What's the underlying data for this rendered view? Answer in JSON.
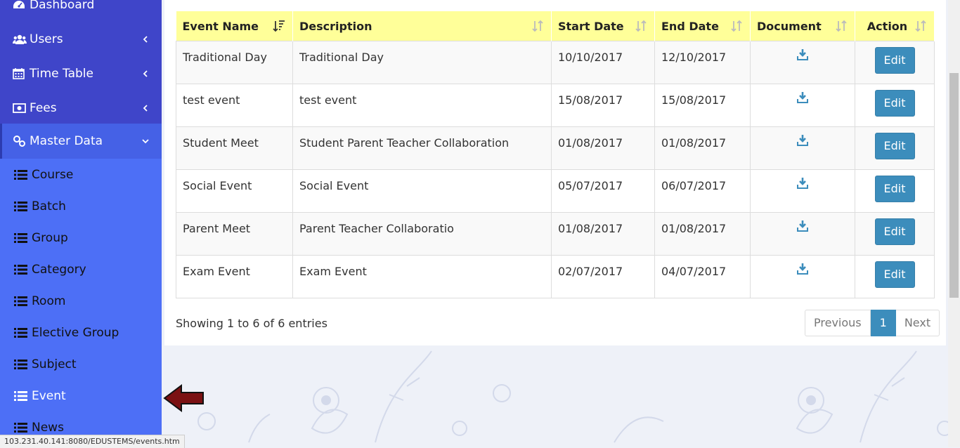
{
  "sidebar": {
    "top_items": [
      {
        "label": "Dashboard",
        "icon": "dashboard-icon"
      },
      {
        "label": "Users",
        "icon": "users-icon"
      },
      {
        "label": "Time Table",
        "icon": "calendar-icon"
      },
      {
        "label": "Fees",
        "icon": "money-icon"
      },
      {
        "label": "Master Data",
        "icon": "settings-icon"
      }
    ],
    "sub_items": [
      "Course",
      "Batch",
      "Group",
      "Category",
      "Room",
      "Elective Group",
      "Subject",
      "Event",
      "News"
    ]
  },
  "table": {
    "headers": [
      "Event Name",
      "Description",
      "Start Date",
      "End Date",
      "Document",
      "Action"
    ],
    "rows": [
      {
        "name": "Traditional Day",
        "description": "Traditional Day",
        "start": "10/10/2017",
        "end": "12/10/2017"
      },
      {
        "name": "test event",
        "description": "test event",
        "start": "15/08/2017",
        "end": "15/08/2017"
      },
      {
        "name": "Student Meet",
        "description": "Student Parent Teacher Collaboration",
        "start": "01/08/2017",
        "end": "01/08/2017"
      },
      {
        "name": "Social Event",
        "description": "Social Event",
        "start": "05/07/2017",
        "end": "06/07/2017"
      },
      {
        "name": "Parent Meet",
        "description": "Parent Teacher Collaboratio",
        "start": "01/08/2017",
        "end": "01/08/2017"
      },
      {
        "name": "Exam Event",
        "description": "Exam Event",
        "start": "02/07/2017",
        "end": "04/07/2017"
      }
    ],
    "edit_label": "Edit"
  },
  "info": "Showing 1 to 6 of 6 entries",
  "pagination": {
    "previous": "Previous",
    "current": "1",
    "next": "Next"
  },
  "status_url": "103.231.40.141:8080/EDUSTEMS/events.htm",
  "colors": {
    "sidebar_top": "#3f45c9",
    "sidebar_sub": "#4d6ff6",
    "header_bg": "#ffff99",
    "button": "#3c8dbc",
    "arrow": "#7b1113"
  }
}
